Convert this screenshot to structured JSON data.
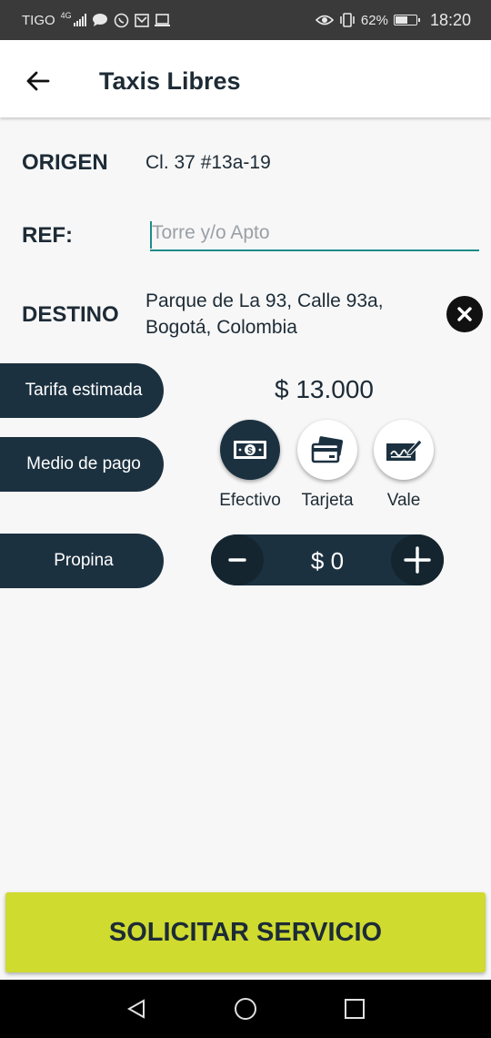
{
  "status_bar": {
    "carrier": "TIGO",
    "network": "4G",
    "battery": "62%",
    "battery_fraction": 0.62,
    "time": "18:20",
    "icons": [
      "signal-icon",
      "chat-icon",
      "whatsapp-icon",
      "mail-icon",
      "screen-icon",
      "eye-icon",
      "vibrate-icon",
      "battery-icon"
    ]
  },
  "app_bar": {
    "title": "Taxis Libres",
    "back_icon": "arrow-left-icon"
  },
  "form": {
    "origin_label": "ORIGEN",
    "origin_value": "Cl. 37 #13a-19",
    "ref_label": "REF:",
    "ref_placeholder": "Torre y/o Apto",
    "ref_value": "",
    "destination_label": "DESTINO",
    "destination_line1": "Parque de La 93, Calle 93a,",
    "destination_line2": "Bogotá, Colombia",
    "clear_icon": "close-circle-icon"
  },
  "fare": {
    "label": "Tarifa estimada",
    "value": "$ 13.000"
  },
  "payment": {
    "label": "Medio de pago",
    "options": [
      {
        "label": "Efectivo",
        "icon": "cash-icon",
        "selected": true
      },
      {
        "label": "Tarjeta",
        "icon": "card-icon",
        "selected": false
      },
      {
        "label": "Vale",
        "icon": "voucher-icon",
        "selected": false
      }
    ]
  },
  "tip": {
    "label": "Propina",
    "value": "$ 0",
    "minus": "−",
    "plus": "+"
  },
  "cta": {
    "label": "SOLICITAR SERVICIO"
  },
  "nav_bar": {
    "icons": [
      "back-triangle-icon",
      "home-circle-icon",
      "recents-square-icon"
    ]
  },
  "colors": {
    "primary_dark": "#1c3140",
    "accent_teal": "#1b8c8a",
    "cta_lime": "#cfdb2f",
    "background": "#f7f7f7"
  }
}
